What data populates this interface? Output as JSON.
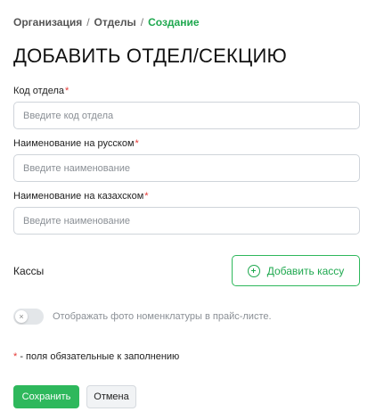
{
  "breadcrumb": {
    "items": [
      "Организация",
      "Отделы",
      "Создание"
    ],
    "separator": "/"
  },
  "page_title": "ДОБАВИТЬ ОТДЕЛ/СЕКЦИЮ",
  "form": {
    "code": {
      "label": "Код отдела",
      "required_mark": "*",
      "placeholder": "Введите код отдела",
      "value": ""
    },
    "name_ru": {
      "label": "Наименование на русском",
      "required_mark": "*",
      "placeholder": "Введите наименование",
      "value": ""
    },
    "name_kz": {
      "label": "Наименование на казахском",
      "required_mark": "*",
      "placeholder": "Введите наименование",
      "value": ""
    }
  },
  "registers": {
    "label": "Кассы",
    "add_button_label": "Добавить кассу",
    "add_button_icon": "plus-circle-icon"
  },
  "photo_toggle": {
    "label": "Отображать фото номенклатуры в прайс-листе.",
    "enabled": false,
    "knob_symbol": "×"
  },
  "required_note": {
    "star": "*",
    "text": " - поля обязательные к заполнению"
  },
  "actions": {
    "save_label": "Сохранить",
    "cancel_label": "Отмена"
  },
  "colors": {
    "accent": "#2eb85c",
    "required": "#e53935",
    "breadcrumb_current": "#1fa84f"
  }
}
